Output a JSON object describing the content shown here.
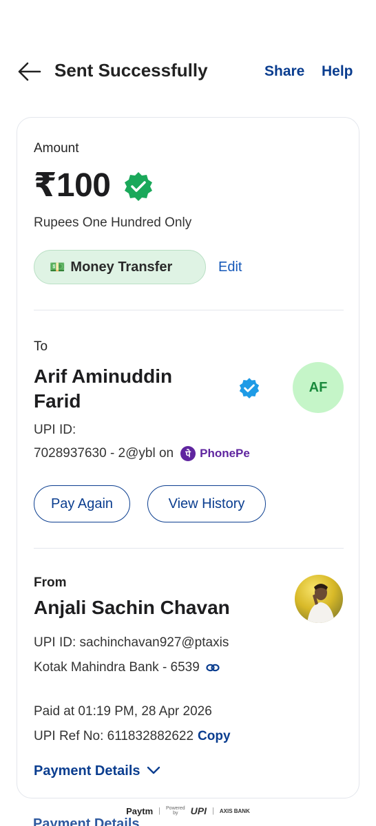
{
  "header": {
    "title": "Sent Successfully",
    "share": "Share",
    "help": "Help"
  },
  "amount": {
    "label": "Amount",
    "value": "₹100",
    "words": "Rupees One Hundred Only",
    "tag_emoji": "💵",
    "tag_label": "Money Transfer",
    "edit": "Edit"
  },
  "to": {
    "label": "To",
    "name": "Arif Aminuddin Farid",
    "initials": "AF",
    "upi_label": "UPI ID:",
    "upi_id": "7028937630 - 2@ybl on",
    "app_logo_glyph": "पे",
    "app_name": "PhonePe",
    "pay_again": "Pay Again",
    "view_history": "View History"
  },
  "from": {
    "label": "From",
    "name": "Anjali Sachin Chavan",
    "upi": "UPI ID: sachinchavan927@ptaxis",
    "bank": "Kotak Mahindra Bank - 6539"
  },
  "transaction": {
    "paid_at": "Paid at 01:19 PM, 28 Apr 2026",
    "ref_label": "UPI Ref No: 611832882622",
    "copy": "Copy",
    "payment_details": "Payment Details",
    "payment_details_ghost": "Payment Details"
  },
  "footer": {
    "paytm": "Paytm",
    "powered_top": "Powered",
    "powered_bottom": "by",
    "upi": "UPI",
    "axis": "AXIS BANK"
  },
  "colors": {
    "primary": "#0a3d8f",
    "verified_green": "#1aa85a",
    "verified_blue": "#1e9be6",
    "tag_bg": "#dff3e4",
    "avatar_bg": "#c5f5c8"
  }
}
